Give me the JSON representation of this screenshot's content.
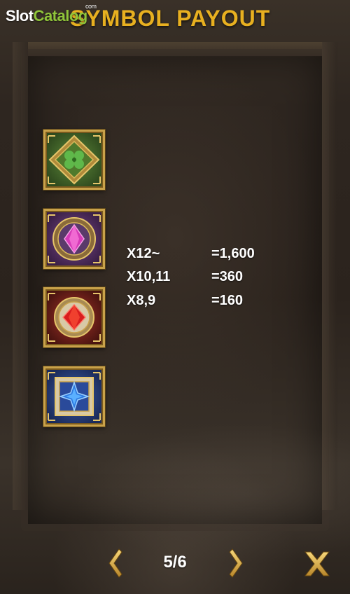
{
  "brand": {
    "logo_part1": "Slot",
    "logo_part2": "Catalog",
    "logo_suffix": "com"
  },
  "header": {
    "title": "SYMBOL PAYOUT"
  },
  "symbols": [
    {
      "name": "green-clover-gem",
      "icon": "clover-icon",
      "frame_color": "#5f8a3a"
    },
    {
      "name": "purple-gem",
      "icon": "purple-gem-icon",
      "frame_color": "#7a4a8a"
    },
    {
      "name": "red-gem",
      "icon": "red-gem-icon",
      "frame_color": "#a8352a"
    },
    {
      "name": "blue-star-gem",
      "icon": "blue-star-icon",
      "frame_color": "#3f5fa8"
    }
  ],
  "payouts": [
    {
      "count": "X12~",
      "value": "=1,600"
    },
    {
      "count": "X10,11",
      "value": "=360"
    },
    {
      "count": "X8,9",
      "value": "=160"
    }
  ],
  "navigation": {
    "page_indicator": "5/6",
    "prev_icon": "chevron-left-icon",
    "next_icon": "chevron-right-icon",
    "close_icon": "close-icon"
  },
  "colors": {
    "title_gold": "#e8b020",
    "frame_gold": "#c9a24a",
    "logo_green": "#8fc43a"
  }
}
